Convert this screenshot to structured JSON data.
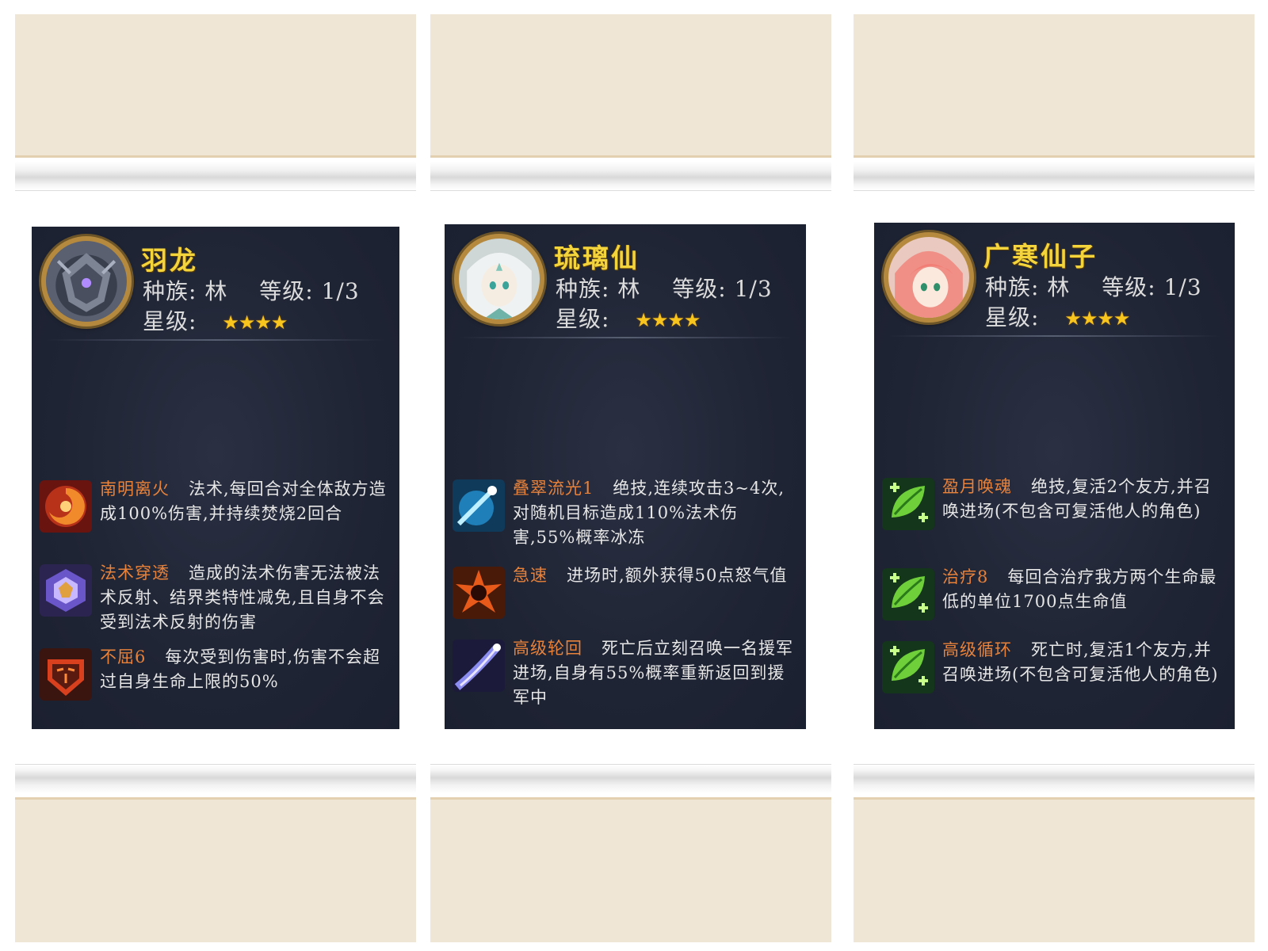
{
  "heroes": [
    {
      "name": "羽龙",
      "race_label": "种族:",
      "race": "林",
      "level_label": "等级:",
      "level": "1/3",
      "star_label": "星级:",
      "stars": 4,
      "avatar_icon": "armored-dragon-portrait",
      "skills": [
        {
          "icon": "fire-swirl-icon",
          "name": "南明离火",
          "desc": "法术,每回合对全体敌方造成100%伤害,并持续焚烧2回合"
        },
        {
          "icon": "purple-crest-icon",
          "name": "法术穿透",
          "desc": "造成的法术伤害无法被法术反射、结界类特性减免,且自身不会受到法术反射的伤害"
        },
        {
          "icon": "red-mask-icon",
          "name": "不屈6",
          "desc": "每次受到伤害时,伤害不会超过自身生命上限的50%"
        }
      ]
    },
    {
      "name": "琉璃仙",
      "race_label": "种族:",
      "race": "林",
      "level_label": "等级:",
      "level": "1/3",
      "star_label": "星级:",
      "stars": 4,
      "avatar_icon": "white-haired-fairy-portrait",
      "skills": [
        {
          "icon": "blue-comet-icon",
          "name": "叠翠流光1",
          "desc": "绝技,连续攻击3~4次,对随机目标造成110%法术伤害,55%概率冰冻"
        },
        {
          "icon": "fire-burst-icon",
          "name": "急速",
          "desc": "进场时,额外获得50点怒气值"
        },
        {
          "icon": "purple-comet-icon",
          "name": "高级轮回",
          "desc": "死亡后立刻召唤一名援军进场,自身有55%概率重新返回到援军中"
        }
      ]
    },
    {
      "name": "广寒仙子",
      "race_label": "种族:",
      "race": "林",
      "level_label": "等级:",
      "level": "1/3",
      "star_label": "星级:",
      "stars": 4,
      "avatar_icon": "pink-haired-fairy-portrait",
      "skills": [
        {
          "icon": "green-leaf-heal-icon",
          "name": "盈月唤魂",
          "desc": "绝技,复活2个友方,并召唤进场(不包含可复活他人的角色)"
        },
        {
          "icon": "green-leaf-heal-icon",
          "name": "治疗8",
          "desc": "每回合治疗我方两个生命最低的单位1700点生命值"
        },
        {
          "icon": "green-leaf-heal-icon",
          "name": "高级循环",
          "desc": "死亡时,复活1个友方,并召唤进场(不包含可复活他人的角色)"
        }
      ]
    }
  ],
  "colors": {
    "card_bg": "#1f2434",
    "hero_name": "#f3d43c",
    "skill_name": "#e8823a",
    "star": "#f7c51e",
    "cream": "#efe6d6"
  }
}
